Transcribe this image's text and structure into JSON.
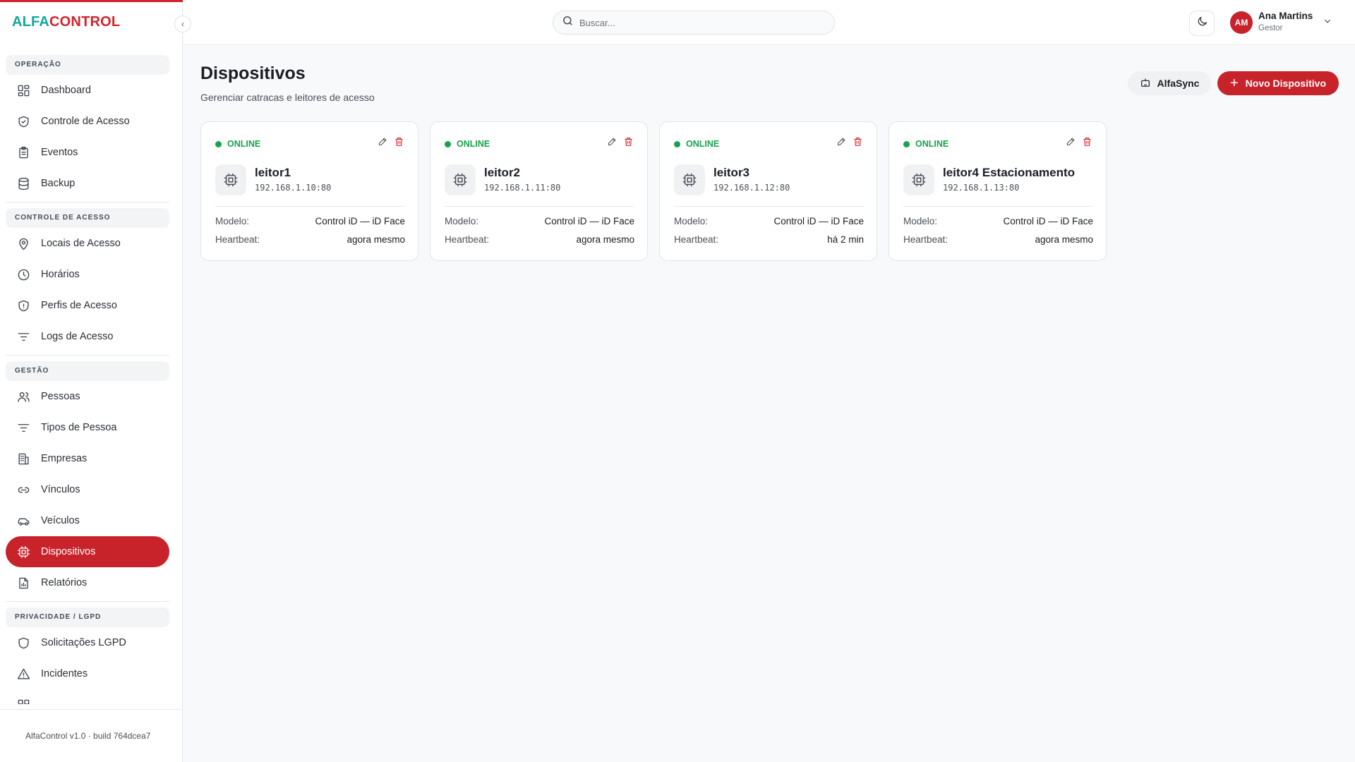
{
  "app": {
    "logo_part1": "ALFA",
    "logo_part2": "CONTROL",
    "version": "AlfaControl v1.0 · build 764dcea7",
    "colors": {
      "brand_red": "#c8232b",
      "brand_teal": "#12a79d",
      "online_green": "#16a34a"
    }
  },
  "sidebar": {
    "collapse_icon": "chevron-left-icon",
    "sections": [
      {
        "title": "OPERAÇÃO",
        "items": [
          {
            "label": "Dashboard",
            "icon": "grid-icon"
          },
          {
            "label": "Controle de Acesso",
            "icon": "shield-check-icon"
          },
          {
            "label": "Eventos",
            "icon": "clipboard-icon"
          },
          {
            "label": "Backup",
            "icon": "database-icon"
          }
        ]
      },
      {
        "title": "CONTROLE DE ACESSO",
        "items": [
          {
            "label": "Locais de Acesso",
            "icon": "map-pin-icon"
          },
          {
            "label": "Horários",
            "icon": "clock-icon"
          },
          {
            "label": "Perfis de Acesso",
            "icon": "shield-alert-icon"
          },
          {
            "label": "Logs de Acesso",
            "icon": "filter-lines-icon"
          }
        ]
      },
      {
        "title": "GESTÃO",
        "items": [
          {
            "label": "Pessoas",
            "icon": "users-icon"
          },
          {
            "label": "Tipos de Pessoa",
            "icon": "filter-lines-icon"
          },
          {
            "label": "Empresas",
            "icon": "building-icon"
          },
          {
            "label": "Vínculos",
            "icon": "link-icon"
          },
          {
            "label": "Veículos",
            "icon": "car-icon"
          },
          {
            "label": "Dispositivos",
            "icon": "cpu-icon",
            "active": true
          },
          {
            "label": "Relatórios",
            "icon": "file-chart-icon"
          }
        ]
      },
      {
        "title": "PRIVACIDADE / LGPD",
        "items": [
          {
            "label": "Solicitações LGPD",
            "icon": "shield-icon"
          },
          {
            "label": "Incidentes",
            "icon": "alert-triangle-icon"
          }
        ]
      }
    ]
  },
  "header": {
    "search_placeholder": "Buscar...",
    "theme_icon": "moon-icon",
    "user": {
      "initials": "AM",
      "name": "Ana Martins",
      "role": "Gestor"
    }
  },
  "main": {
    "title": "Dispositivos",
    "subtitle": "Gerenciar catracas e leitores de acesso",
    "sync_label": "AlfaSync",
    "new_label": "Novo Dispositivo",
    "model_label": "Modelo:",
    "heartbeat_label": "Heartbeat:",
    "devices": [
      {
        "status": "ONLINE",
        "name": "leitor1",
        "ip": "192.168.1.10:80",
        "model": "Control iD — iD Face",
        "heartbeat": "agora mesmo"
      },
      {
        "status": "ONLINE",
        "name": "leitor2",
        "ip": "192.168.1.11:80",
        "model": "Control iD — iD Face",
        "heartbeat": "agora mesmo"
      },
      {
        "status": "ONLINE",
        "name": "leitor3",
        "ip": "192.168.1.12:80",
        "model": "Control iD — iD Face",
        "heartbeat": "há 2 min"
      },
      {
        "status": "ONLINE",
        "name": "leitor4 Estacionamento",
        "ip": "192.168.1.13:80",
        "model": "Control iD — iD Face",
        "heartbeat": "agora mesmo"
      }
    ]
  }
}
